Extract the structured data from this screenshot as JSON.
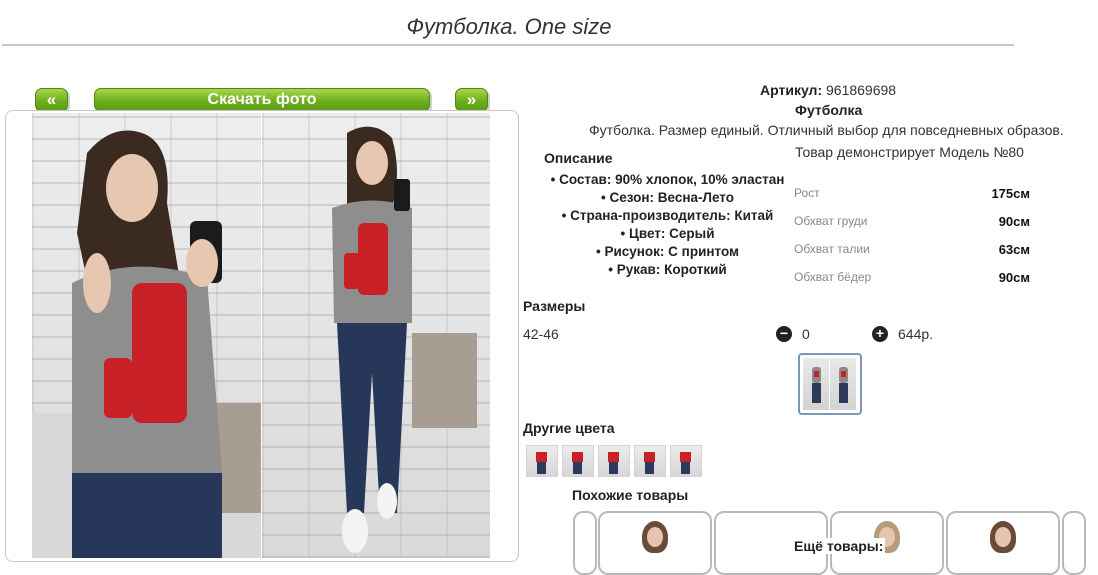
{
  "page_title": "Футболка. One size",
  "nav": {
    "prev_label": "«",
    "download_label": "Скачать фото",
    "next_label": "»"
  },
  "product": {
    "article_label": "Артикул:",
    "article_value": "961869698",
    "name": "Футболка",
    "summary": "Футболка. Размер единый. Отличный выбор для повседневных образов.",
    "model_note": "Товар демонстрирует Модель №80"
  },
  "description": {
    "heading": "Описание",
    "items": [
      "Состав: 90% хлопок, 10% эластан",
      "Сезон: Весна-Лето",
      "Страна-производитель: Китай",
      "Цвет: Серый",
      "Рисунок: С принтом",
      "Рукав: Короткий"
    ]
  },
  "measurements": [
    {
      "label": "Рост",
      "value": "175см"
    },
    {
      "label": "Обхват груди",
      "value": "90см"
    },
    {
      "label": "Обхват талии",
      "value": "63см"
    },
    {
      "label": "Обхват бёдер",
      "value": "90см"
    }
  ],
  "sizes": {
    "heading": "Размеры",
    "row": {
      "size": "42-46",
      "minus_icon": "minus-circle-icon",
      "quantity": "0",
      "plus_icon": "plus-circle-icon",
      "price": "644р."
    }
  },
  "other_colors": {
    "heading": "Другие цвета",
    "count": 5
  },
  "similar": {
    "heading": "Похожие товары"
  },
  "more": {
    "heading": "Ещё товары:"
  },
  "colors": {
    "button_green": "#6fae1d",
    "frame_border": "#c6c6c6",
    "print_red": "#c82027"
  }
}
